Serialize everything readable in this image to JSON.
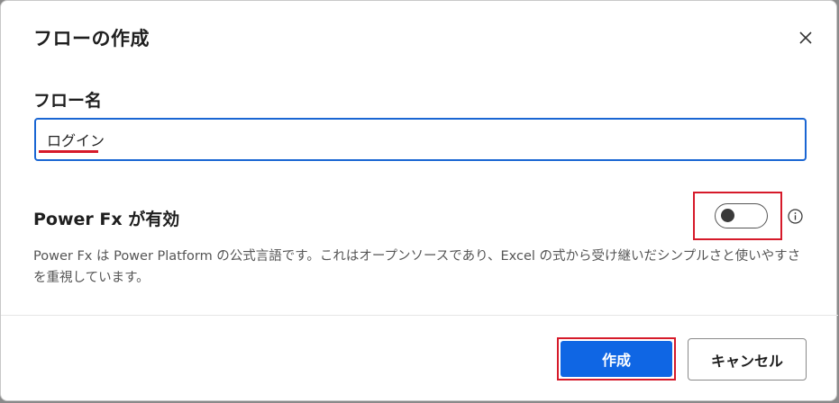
{
  "dialog": {
    "title": "フローの作成",
    "close_icon": "close-icon"
  },
  "flow_name": {
    "label": "フロー名",
    "value": "ログイン"
  },
  "power_fx": {
    "label": "Power Fx が有効",
    "toggle_state": "off",
    "info_icon": "info-icon",
    "description": "Power Fx は Power Platform の公式言語です。これはオープンソースであり、Excel の式から受け継いだシンプルさと使いやすさを重視しています。"
  },
  "footer": {
    "create_label": "作成",
    "cancel_label": "キャンセル"
  },
  "colors": {
    "primary": "#0f66e4",
    "highlight": "#d61a2a",
    "input_border": "#1a66d3"
  }
}
